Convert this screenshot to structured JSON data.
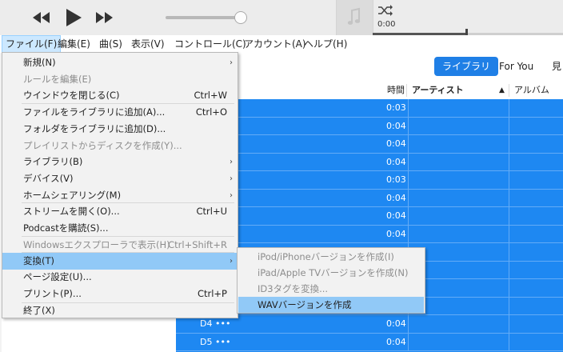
{
  "player": {
    "time": "0:00",
    "progress_fraction": 0.5,
    "volume_fraction": 0.9,
    "icons": [
      "rewind-icon",
      "play-icon",
      "fast-forward-icon",
      "music-note-icon",
      "shuffle-icon"
    ]
  },
  "menubar": {
    "items": [
      "ファイル(F)",
      "編集(E)",
      "曲(S)",
      "表示(V)",
      "コントロール(C)",
      "アカウント(A)",
      "ヘルプ(H)"
    ]
  },
  "nav": {
    "library": "ライブラリ",
    "for_you": "For You",
    "browse": "見"
  },
  "columns": {
    "time": "時間",
    "artist": "アーティスト",
    "album": "アルバム"
  },
  "rows": [
    {
      "name": "",
      "time": "0:03"
    },
    {
      "name": "",
      "time": "0:04"
    },
    {
      "name": "",
      "time": "0:04"
    },
    {
      "name": "",
      "time": "0:04"
    },
    {
      "name": "",
      "time": "0:03"
    },
    {
      "name": "",
      "time": "0:04"
    },
    {
      "name": "",
      "time": "0:04"
    },
    {
      "name": "",
      "time": "0:04"
    },
    {
      "name": "",
      "time": ""
    },
    {
      "name": "",
      "time": ""
    },
    {
      "name": "",
      "time": ""
    },
    {
      "name": "",
      "time": ""
    },
    {
      "name": "D4 •••",
      "time": "0:04"
    },
    {
      "name": "D5 •••",
      "time": "0:04"
    }
  ],
  "file_menu": {
    "items": [
      {
        "label": "新規(N)",
        "shortcut": "",
        "submenu": true,
        "enabled": true
      },
      {
        "label": "ルールを編集(E)",
        "shortcut": "",
        "submenu": false,
        "enabled": false
      },
      {
        "label": "ウインドウを閉じる(C)",
        "shortcut": "Ctrl+W",
        "submenu": false,
        "enabled": true
      },
      {
        "label": "ファイルをライブラリに追加(A)...",
        "shortcut": "Ctrl+O",
        "submenu": false,
        "enabled": true
      },
      {
        "label": "フォルダをライブラリに追加(D)...",
        "shortcut": "",
        "submenu": false,
        "enabled": true
      },
      {
        "label": "プレイリストからディスクを作成(Y)...",
        "shortcut": "",
        "submenu": false,
        "enabled": false
      },
      {
        "label": "ライブラリ(B)",
        "shortcut": "",
        "submenu": true,
        "enabled": true
      },
      {
        "label": "デバイス(V)",
        "shortcut": "",
        "submenu": true,
        "enabled": true
      },
      {
        "label": "ホームシェアリング(M)",
        "shortcut": "",
        "submenu": true,
        "enabled": true
      },
      {
        "label": "ストリームを開く(O)...",
        "shortcut": "Ctrl+U",
        "submenu": false,
        "enabled": true
      },
      {
        "label": "Podcastを購読(S)...",
        "shortcut": "",
        "submenu": false,
        "enabled": true
      },
      {
        "label": "Windowsエクスプローラで表示(H)",
        "shortcut": "Ctrl+Shift+R",
        "submenu": false,
        "enabled": false
      },
      {
        "label": "変換(T)",
        "shortcut": "",
        "submenu": true,
        "enabled": true,
        "highlighted": true
      },
      {
        "label": "ページ設定(U)...",
        "shortcut": "",
        "submenu": false,
        "enabled": true
      },
      {
        "label": "プリント(P)...",
        "shortcut": "Ctrl+P",
        "submenu": false,
        "enabled": true
      },
      {
        "label": "終了(X)",
        "shortcut": "",
        "submenu": false,
        "enabled": true
      }
    ]
  },
  "convert_submenu": {
    "items": [
      {
        "label": "iPod/iPhoneバージョンを作成(I)",
        "enabled": false
      },
      {
        "label": "iPad/Apple TVバージョンを作成(N)",
        "enabled": false
      },
      {
        "label": "ID3タグを変換...",
        "enabled": false
      },
      {
        "label": "WAVバージョンを作成",
        "enabled": true,
        "highlighted": true
      }
    ]
  },
  "colors": {
    "selection": "#1e88f2",
    "menu_highlight": "#91c9f7",
    "accent": "#1f7fe6"
  }
}
